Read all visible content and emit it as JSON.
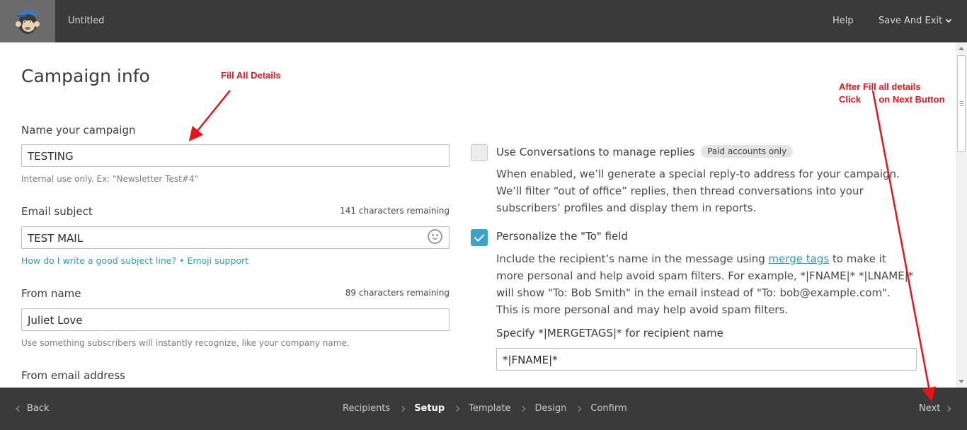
{
  "header": {
    "doc_title": "Untitled",
    "help": "Help",
    "save_exit": "Save And Exit"
  },
  "page_title": "Campaign info",
  "campaign_name": {
    "label": "Name your campaign",
    "value": "TESTING",
    "hint": "Internal use only. Ex: \"Newsletter Test#4\""
  },
  "subject": {
    "label": "Email subject",
    "remaining": "141 characters remaining",
    "value": "TEST MAIL",
    "help_link": "How do I write a good subject line?",
    "separator": " • ",
    "emoji_link": "Emoji support"
  },
  "from_name": {
    "label": "From name",
    "remaining": "89 characters remaining",
    "value": "Juliet Love",
    "hint": "Use something subscribers will instantly recognize, like your company name."
  },
  "from_email": {
    "label": "From email address"
  },
  "conversations": {
    "checked": false,
    "title": "Use Conversations to manage replies",
    "badge": "Paid accounts only",
    "description": "When enabled, we’ll generate a special reply-to address for your campaign. We’ll filter “out of office” replies, then thread conversations into your subscribers’ profiles and display them in reports."
  },
  "personalize": {
    "checked": true,
    "title": "Personalize the \"To\" field",
    "desc_before": "Include the recipient’s name in the message using ",
    "merge_link": "merge tags",
    "desc_after": " to make it more personal and help avoid spam filters. For example, *|FNAME|* *|LNAME|* will show \"To: Bob Smith\" in the email instead of \"To: bob@example.com\". This is more personal and may help avoid spam filters.",
    "mergetag_label": "Specify *|MERGETAGS|* for recipient name",
    "mergetag_value": "*|FNAME|*"
  },
  "footer": {
    "back": "Back",
    "next": "Next",
    "steps": [
      {
        "label": "Recipients",
        "active": false
      },
      {
        "label": "Setup",
        "active": true
      },
      {
        "label": "Template",
        "active": false
      },
      {
        "label": "Design",
        "active": false
      },
      {
        "label": "Confirm",
        "active": false
      }
    ]
  },
  "annotations": {
    "fill_details": "Fill All Details",
    "after_fill_line1": "After Fill all details",
    "after_fill_line2": "Click       on Next Button"
  },
  "colors": {
    "topbar": "#3a3a3a",
    "accent": "#2b9cb5",
    "checkbox_on": "#3aa3c9",
    "annotation": "#e8141a"
  }
}
